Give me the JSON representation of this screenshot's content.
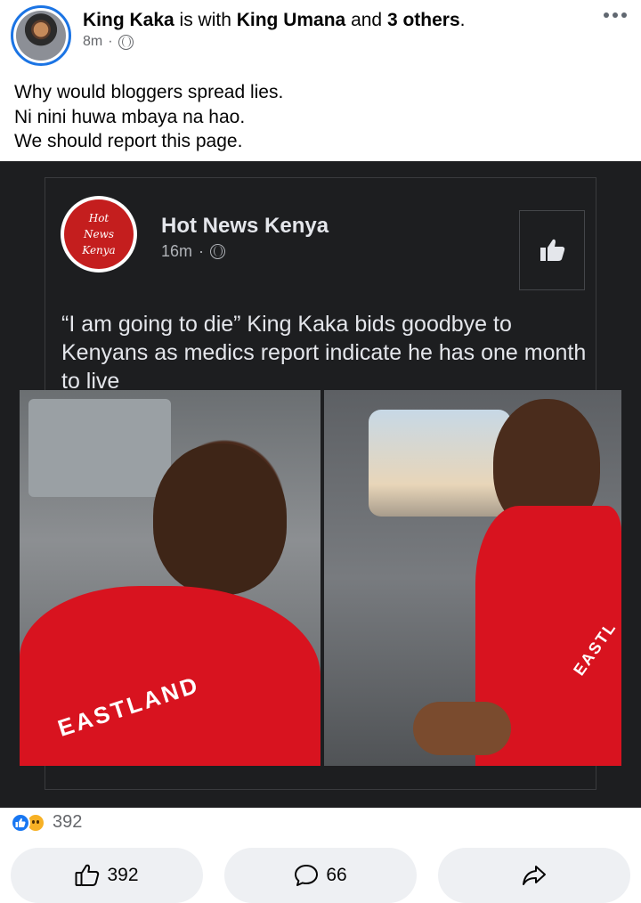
{
  "post": {
    "author": "King Kaka",
    "with_text": " is with ",
    "tagged": "King Umana",
    "and_text": " and ",
    "others": "3 others",
    "period": ".",
    "time": "8m",
    "dot": "·",
    "caption_lines": [
      "Why would bloggers spread lies.",
      "Ni nini huwa mbaya na hao.",
      "We should report this page."
    ],
    "audience_icon": "globe-icon",
    "more_icon": "more-options-icon"
  },
  "shared_image": {
    "logo_text": [
      "Hot",
      "News",
      "Kenya"
    ],
    "page_name": "Hot News Kenya",
    "time": "16m",
    "dot": "·",
    "headline": "“I am going to die” King Kaka bids goodbye to Kenyans as medics report indicate he has one month to live",
    "hoodie_left_text": "EASTLAND",
    "hoodie_right_text": "EASTL"
  },
  "reactions": {
    "count": "392",
    "types": [
      "like",
      "sad"
    ]
  },
  "actions": {
    "like_count": "392",
    "comment_count": "66"
  },
  "colors": {
    "brand_blue": "#1877f2",
    "hoodie_red": "#d8131f",
    "dark_bg": "#1d1e20"
  }
}
